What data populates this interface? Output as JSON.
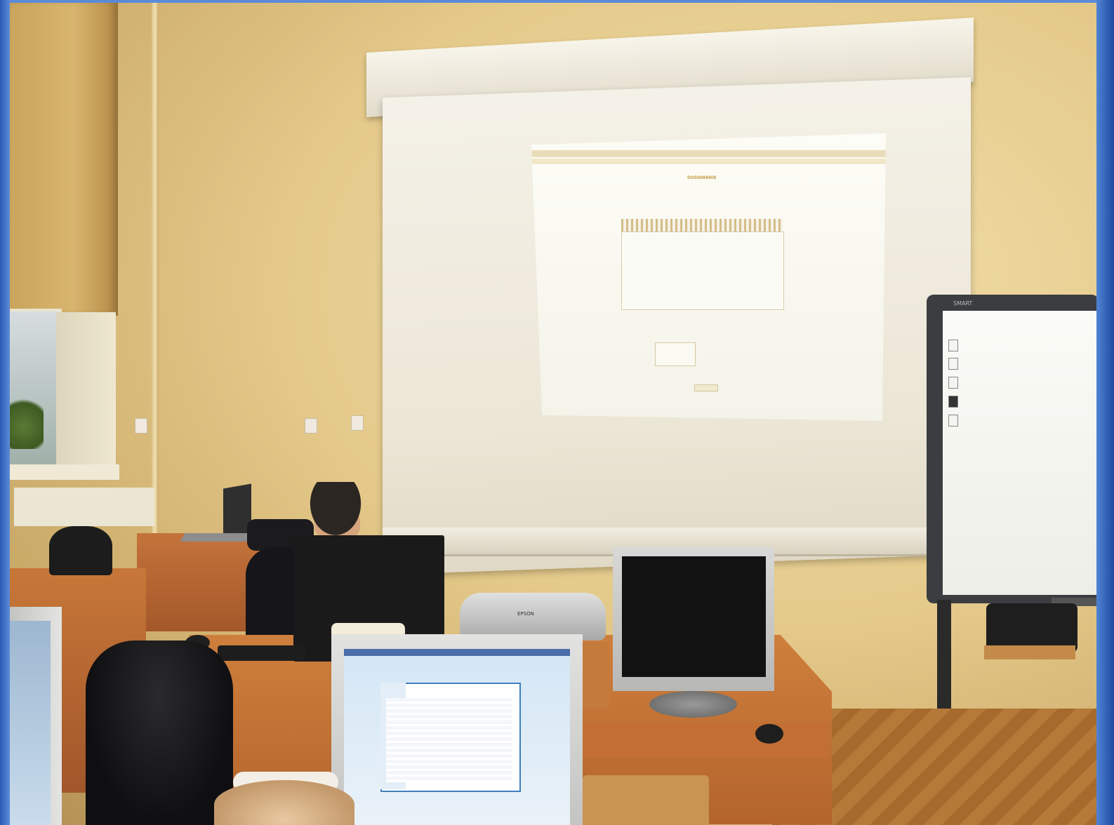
{
  "image": {
    "kind": "photo",
    "scene": "classroom"
  },
  "projected_screen": {
    "title_text": "DODAWANIE"
  },
  "whiteboard": {
    "brand": "SMART"
  },
  "projector": {
    "brand": "EPSON"
  },
  "colors": {
    "wall": "#e4c98a",
    "desk": "#c77738",
    "frame": "#2b5bb8",
    "screen": "#f4f1e8"
  }
}
